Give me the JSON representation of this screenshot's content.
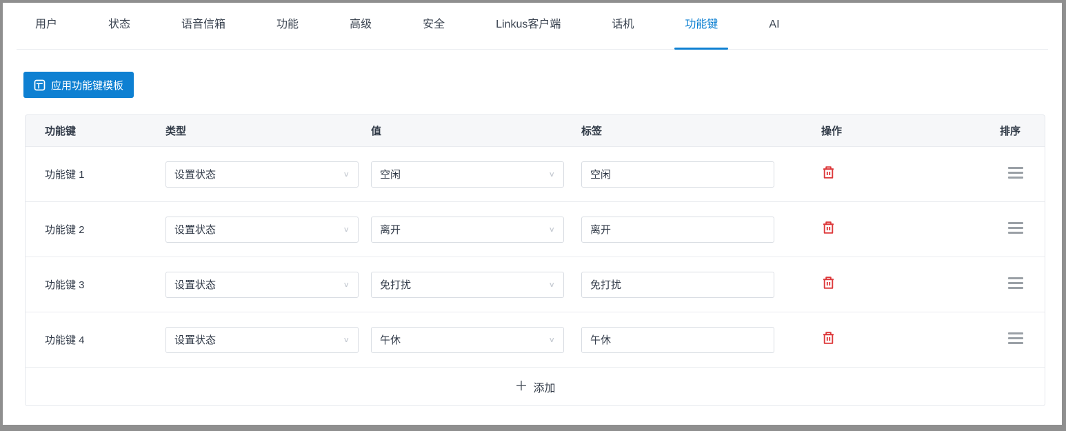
{
  "accent_color": "#0e80d2",
  "danger_color": "#dd3a3c",
  "tabs": {
    "items": [
      {
        "label": "用户",
        "active": false
      },
      {
        "label": "状态",
        "active": false
      },
      {
        "label": "语音信箱",
        "active": false
      },
      {
        "label": "功能",
        "active": false
      },
      {
        "label": "高级",
        "active": false
      },
      {
        "label": "安全",
        "active": false
      },
      {
        "label": "Linkus客户端",
        "active": false
      },
      {
        "label": "话机",
        "active": false
      },
      {
        "label": "功能键",
        "active": true
      },
      {
        "label": "AI",
        "active": false
      }
    ]
  },
  "toolbar": {
    "apply_template_label": "应用功能键模板"
  },
  "table": {
    "headers": {
      "key": "功能键",
      "type": "类型",
      "value": "值",
      "label": "标签",
      "operations": "操作",
      "sort": "排序"
    },
    "rows": [
      {
        "key": "功能键 1",
        "type": "设置状态",
        "value": "空闲",
        "label": "空闲"
      },
      {
        "key": "功能键 2",
        "type": "设置状态",
        "value": "离开",
        "label": "离开"
      },
      {
        "key": "功能键 3",
        "type": "设置状态",
        "value": "免打扰",
        "label": "免打扰"
      },
      {
        "key": "功能键 4",
        "type": "设置状态",
        "value": "午休",
        "label": "午休"
      }
    ],
    "add_label": "添加"
  }
}
